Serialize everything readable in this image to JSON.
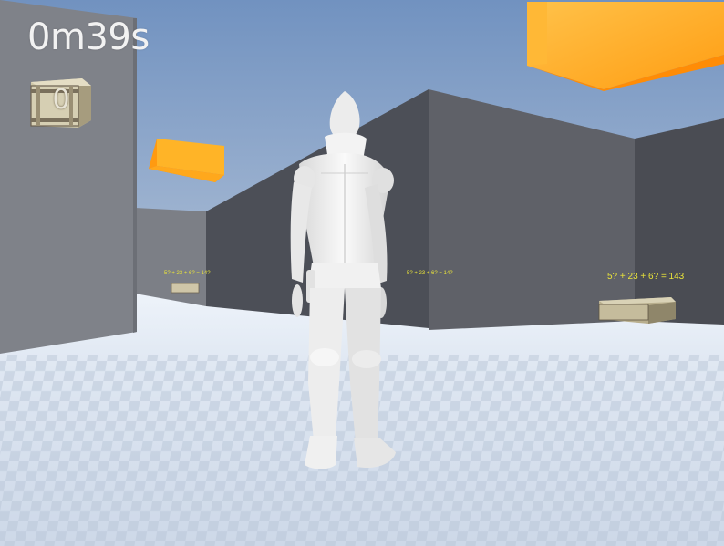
{
  "hud": {
    "timer": "0m39s",
    "collected_count": "0",
    "crate_icon": "crate-icon"
  },
  "world": {
    "clues": [
      {
        "text": "5? + 23 + 6? = 14?"
      },
      {
        "text": "5? + 23 + 6? = 14?"
      },
      {
        "text": "5? + 23 + 6? = 143"
      }
    ],
    "colors": {
      "sky": "#6f8fb8",
      "floor": "#e6edf7",
      "wall": "#5e6068",
      "floating_block": "#ffa61f",
      "character": "#eeeeee",
      "clue_text": "#e9e33a"
    }
  }
}
